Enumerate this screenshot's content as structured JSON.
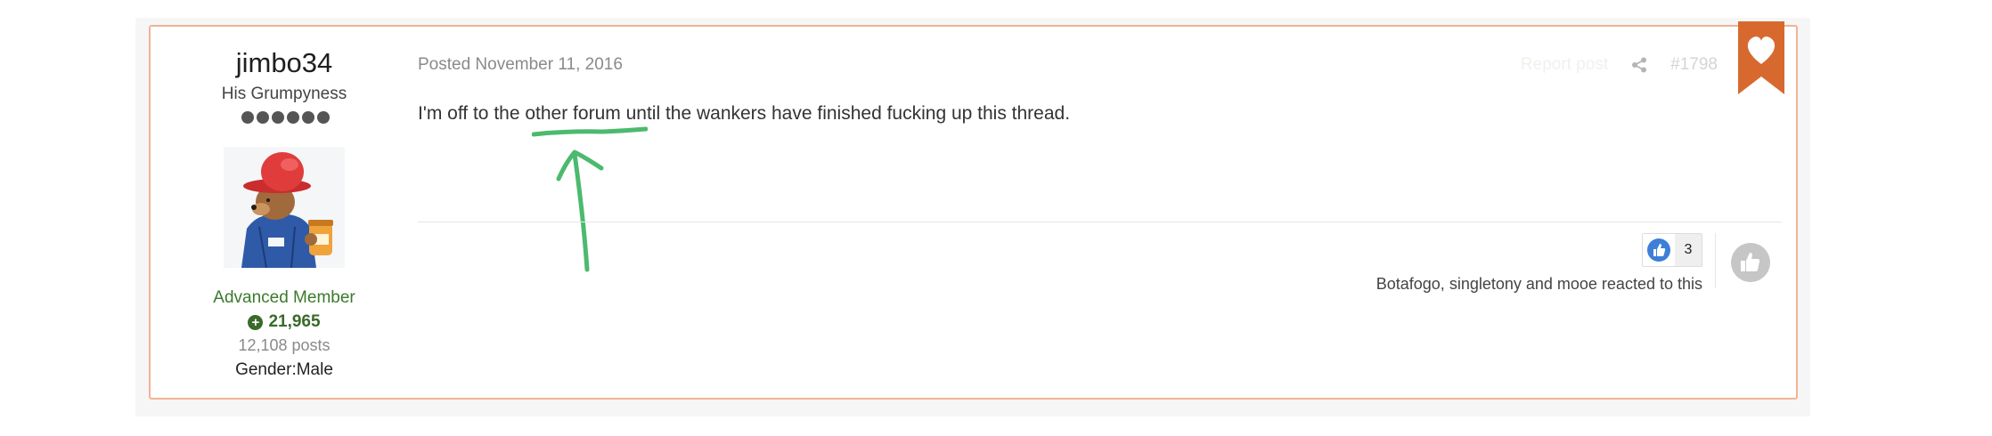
{
  "author": {
    "name": "jimbo34",
    "title": "His Grumpyness",
    "rank_pips": 6,
    "group": "Advanced Member",
    "reputation": "21,965",
    "posts": "12,108 posts",
    "gender": "Gender:Male"
  },
  "post": {
    "posted": "Posted November 11, 2016",
    "report_label": "Report post",
    "post_number": "#1798",
    "body": {
      "before": "I'm off to the ",
      "link": "other forum",
      "after": " until the wankers have finished fucking up this thread."
    }
  },
  "reactions": {
    "count": "3",
    "summary": "Botafogo, singletony and mooe reacted to this"
  },
  "colors": {
    "accent": "#e07b39",
    "post_border": "#f1b493",
    "member_group": "#3a7a2b",
    "annotation": "#4cba6e",
    "reaction_blue": "#3d7fd8"
  },
  "icons": [
    "share-icon",
    "bookmark-heart-icon",
    "thumbs-up-icon",
    "plus-icon"
  ]
}
